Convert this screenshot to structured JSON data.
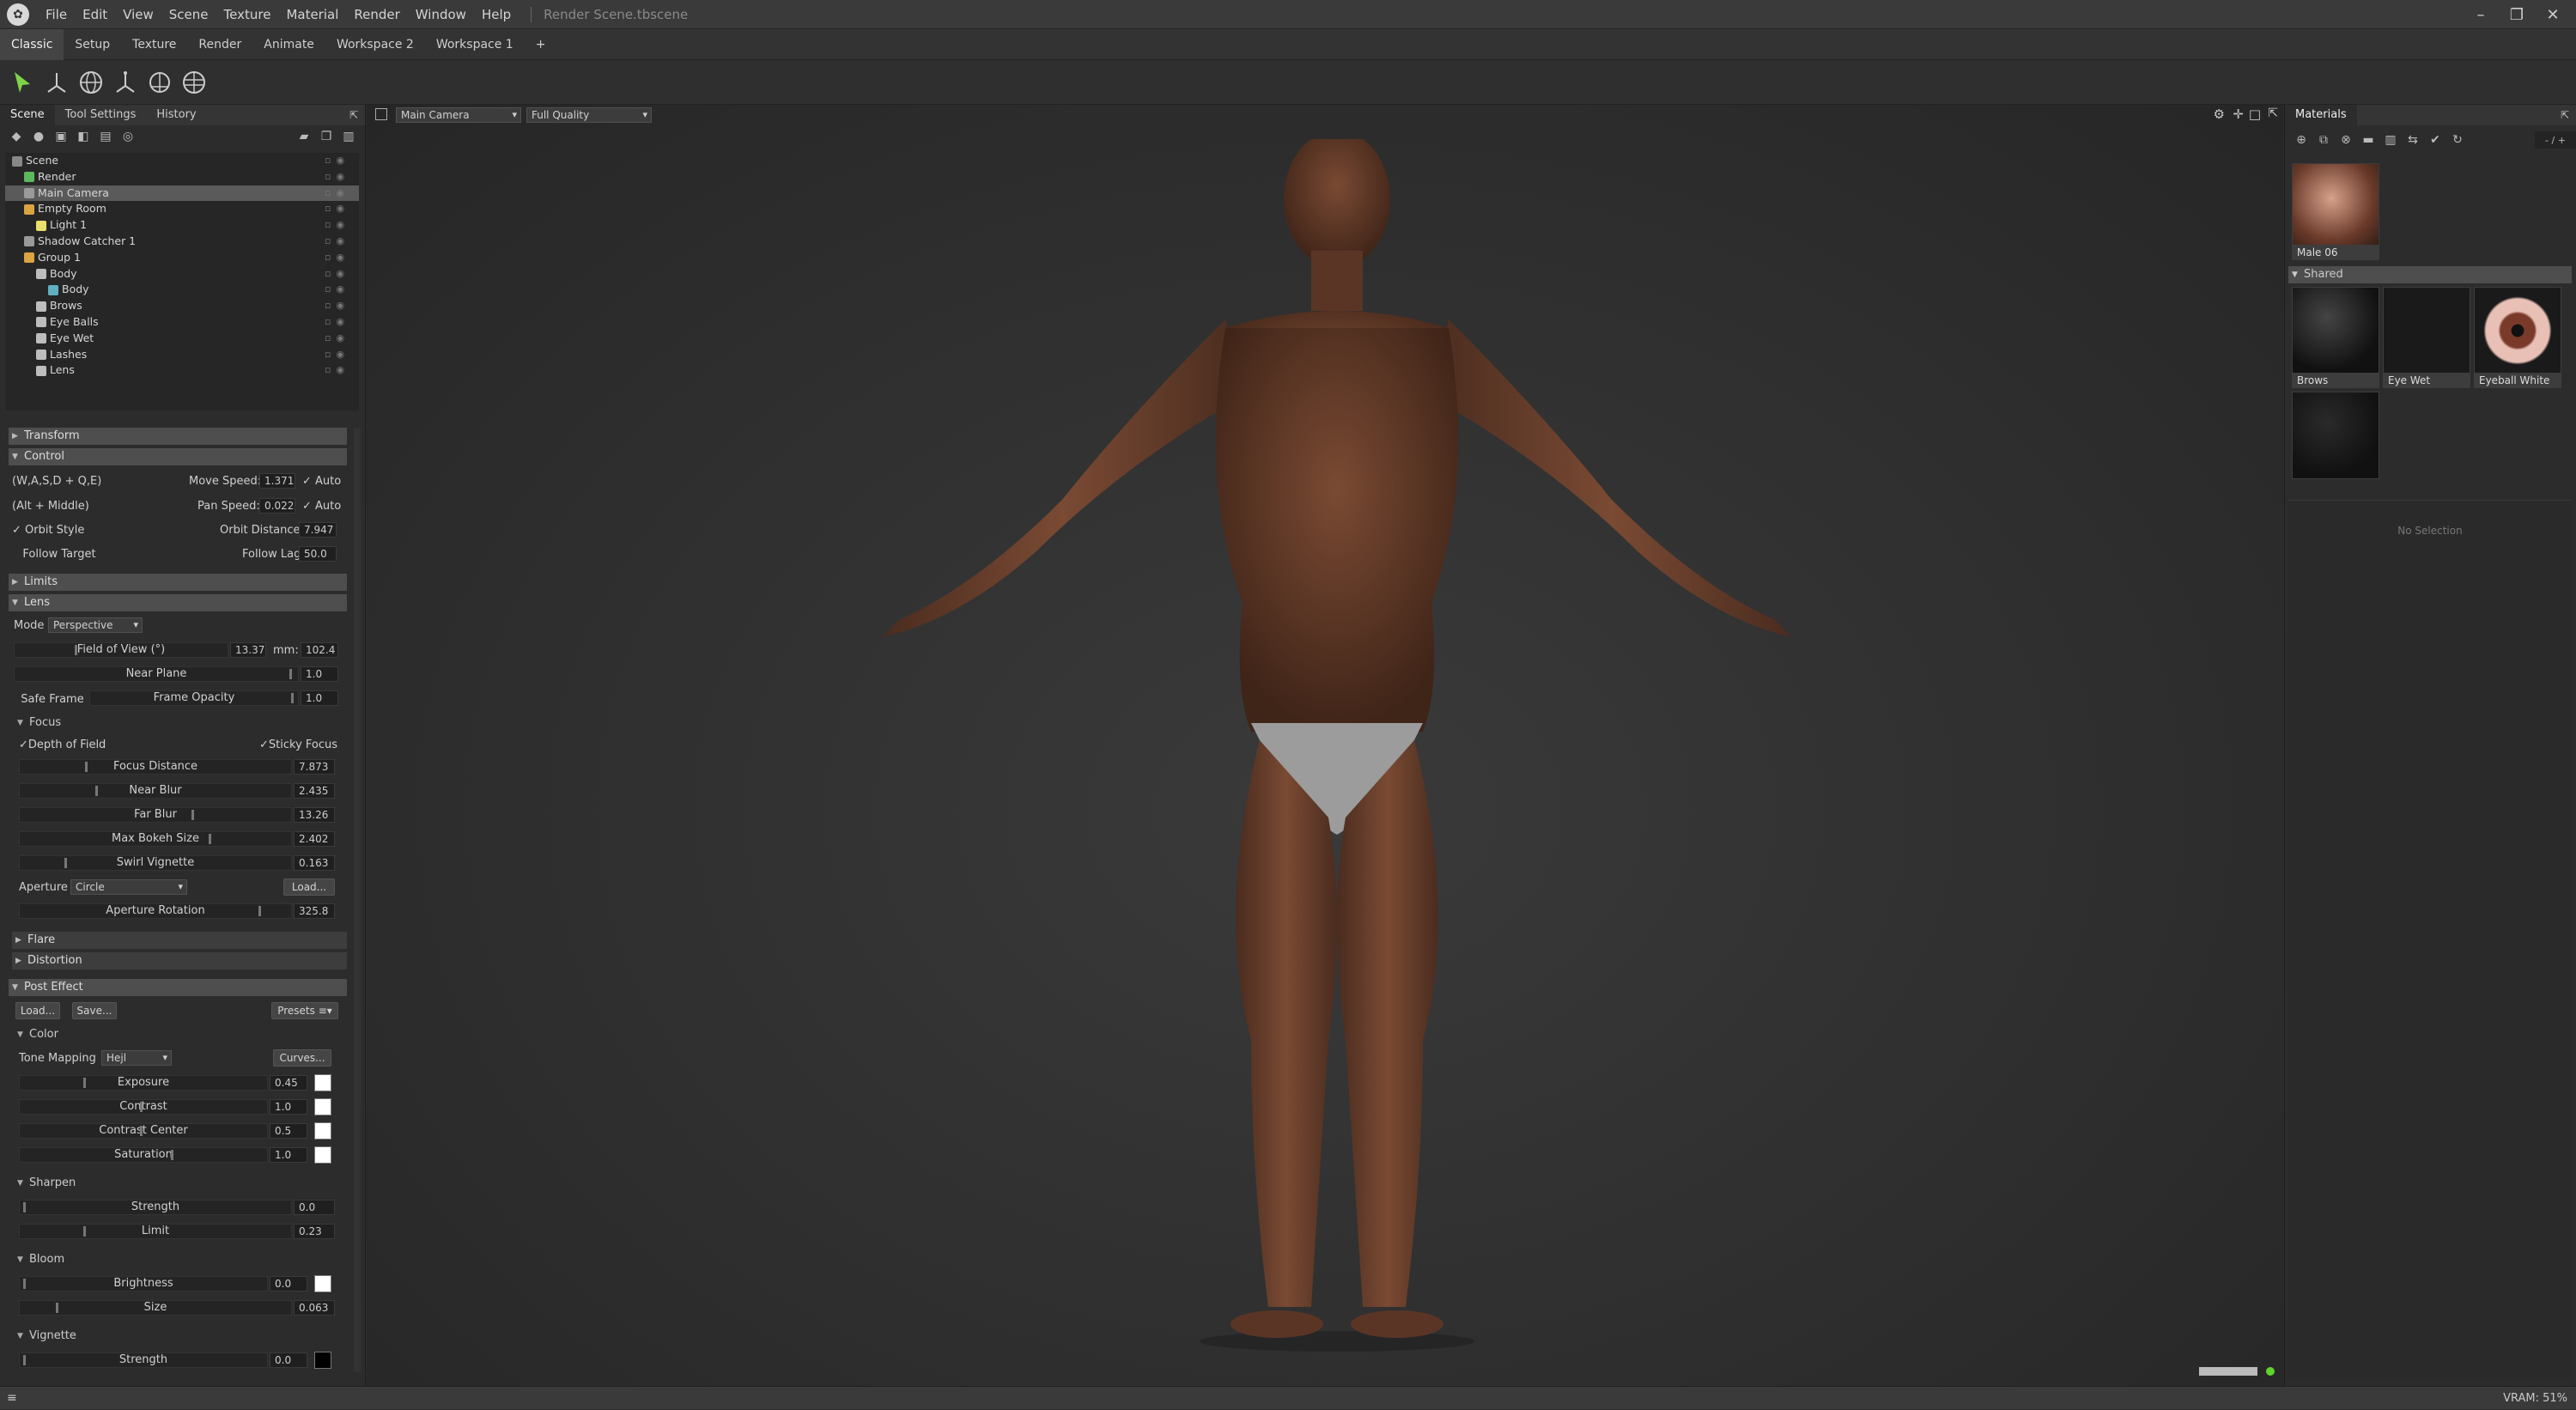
{
  "app": {
    "title_menu": [
      "File",
      "Edit",
      "View",
      "Scene",
      "Texture",
      "Material",
      "Render",
      "Window",
      "Help"
    ],
    "document": "Render Scene.tbscene"
  },
  "workspaces": [
    "Classic",
    "Setup",
    "Texture",
    "Render",
    "Animate",
    "Workspace 2",
    "Workspace 1",
    "+"
  ],
  "left": {
    "tabs": [
      "Scene",
      "Tool Settings",
      "History"
    ],
    "tree": [
      {
        "label": "Scene",
        "indent": 0,
        "icon": "scene-icon"
      },
      {
        "label": "Render",
        "indent": 1,
        "icon": "render-icon"
      },
      {
        "label": "Main Camera",
        "indent": 1,
        "icon": "camera-icon",
        "selected": true
      },
      {
        "label": "Empty Room",
        "indent": 1,
        "icon": "room-icon"
      },
      {
        "label": "Light 1",
        "indent": 2,
        "icon": "light-icon"
      },
      {
        "label": "Shadow Catcher 1",
        "indent": 1,
        "icon": "shadow-icon"
      },
      {
        "label": "Group 1",
        "indent": 1,
        "icon": "folder-icon"
      },
      {
        "label": "Body",
        "indent": 2,
        "icon": "mesh-icon"
      },
      {
        "label": "Body",
        "indent": 3,
        "icon": "material-icon"
      },
      {
        "label": "Brows",
        "indent": 2,
        "icon": "mesh-icon"
      },
      {
        "label": "Eye Balls",
        "indent": 2,
        "icon": "mesh-icon"
      },
      {
        "label": "Eye Wet",
        "indent": 2,
        "icon": "mesh-icon"
      },
      {
        "label": "Lashes",
        "indent": 2,
        "icon": "mesh-icon"
      },
      {
        "label": "Lens",
        "indent": 2,
        "icon": "mesh-icon"
      }
    ],
    "sections": {
      "transform": "Transform",
      "control": "Control",
      "limits": "Limits",
      "lens": "Lens",
      "focus": "Focus",
      "flare": "Flare",
      "distortion": "Distortion",
      "post": "Post Effect",
      "color": "Color",
      "sharpen": "Sharpen",
      "bloom": "Bloom",
      "vignette": "Vignette"
    },
    "control": {
      "wasd": "(W,A,S,D + Q,E)",
      "move_speed_label": "Move Speed:",
      "move_speed": "1.371",
      "auto": "Auto",
      "altmid": "(Alt + Middle)",
      "pan_speed_label": "Pan Speed:",
      "pan_speed": "0.022",
      "orbit_style": "Orbit Style",
      "orbit_dist_label": "Orbit Distance:",
      "orbit_dist": "7.947",
      "follow_target": "Follow Target",
      "follow_lag_label": "Follow Lag",
      "follow_lag": "50.0"
    },
    "lens": {
      "mode_label": "Mode",
      "mode": "Perspective",
      "fov_label": "Field of View (°)",
      "fov": "13.37",
      "mm_label": "mm:",
      "mm": "102.4",
      "near_plane_label": "Near Plane",
      "near_plane": "1.0",
      "safe_frame": "Safe Frame",
      "frame_opacity_label": "Frame Opacity",
      "frame_opacity": "1.0"
    },
    "focus": {
      "dof": "Depth of Field",
      "sticky": "Sticky Focus",
      "focus_distance_label": "Focus Distance",
      "focus_distance": "7.873",
      "near_blur_label": "Near Blur",
      "near_blur": "2.435",
      "far_blur_label": "Far Blur",
      "far_blur": "13.26",
      "max_bokeh_label": "Max Bokeh Size",
      "max_bokeh": "2.402",
      "swirl_label": "Swirl Vignette",
      "swirl": "0.163",
      "aperture_label": "Aperture",
      "aperture": "Circle",
      "load": "Load...",
      "aperture_rot_label": "Aperture Rotation",
      "aperture_rot": "325.8"
    },
    "post": {
      "load": "Load...",
      "save": "Save...",
      "presets": "Presets",
      "tone_label": "Tone Mapping",
      "tone": "Hejl",
      "curves": "Curves...",
      "exposure_label": "Exposure",
      "exposure": "0.45",
      "contrast_label": "Contrast",
      "contrast": "1.0",
      "contrast_center_label": "Contrast Center",
      "contrast_center": "0.5",
      "saturation_label": "Saturation",
      "saturation": "1.0",
      "sh_strength_label": "Strength",
      "sh_strength": "0.0",
      "limit_label": "Limit",
      "limit": "0.23",
      "brightness_label": "Brightness",
      "brightness": "0.0",
      "size_label": "Size",
      "size": "0.063",
      "vig_strength_label": "Strength",
      "vig_strength": "0.0"
    }
  },
  "viewport": {
    "camera": "Main Camera",
    "quality": "Full Quality"
  },
  "right": {
    "title": "Materials",
    "count": "- / +",
    "selected_material": "Male 06",
    "shared": "Shared",
    "materials": [
      "Brows",
      "Eye Wet",
      "Eyeball White",
      ""
    ],
    "no_selection": "No Selection"
  },
  "status": {
    "vram": "VRAM: 51%"
  }
}
